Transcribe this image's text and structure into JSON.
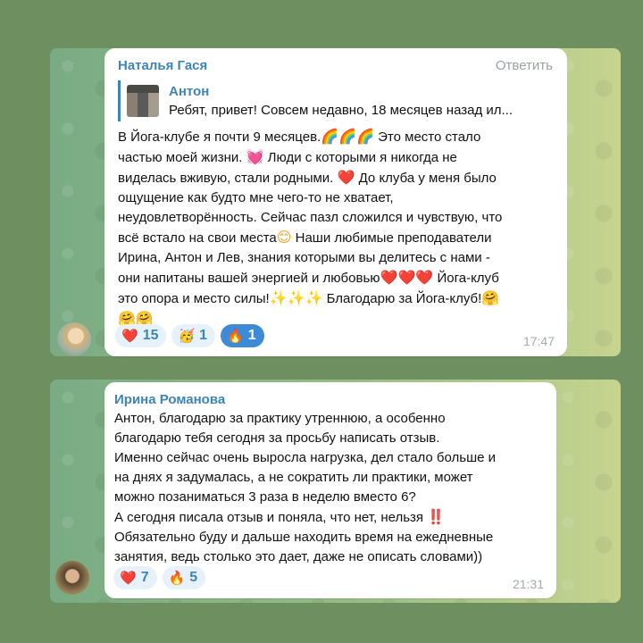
{
  "messages": [
    {
      "sender": "Наталья Гася",
      "reply_action": "Ответить",
      "quote": {
        "author": "Антон",
        "text": "Ребят, привет!  Совсем недавно, 18 месяцев назад ил..."
      },
      "lines": [
        [
          "В Йога-клубе я почти 9 месяцев.",
          "🌈🌈🌈",
          " Это место стало"
        ],
        [
          "частью моей жизни. ",
          "💓",
          " Люди с которыми я никогда не"
        ],
        [
          "виделась вживую, стали родными. ",
          "❤️",
          " До клуба у меня было"
        ],
        [
          "ощущение как будто мне чего-то не хватает,"
        ],
        [
          "неудовлетворённость. Сейчас пазл сложился и чувствую, что"
        ],
        [
          "всё встало на свои места",
          "😊",
          " Наши любимые преподаватели"
        ],
        [
          "Ирина, Антон и Лев, знания которыми вы делитесь с нами -"
        ],
        [
          "они напитаны вашей энергией и любовью",
          "❤️❤️❤️",
          " Йога-клуб"
        ],
        [
          "это опора и место силы!",
          "✨✨✨",
          "  Благодарю за Йога-клуб!",
          "🤗"
        ],
        [
          "",
          "🤗🤗"
        ]
      ],
      "reactions": [
        {
          "icon": "❤️",
          "icon_name": "heart-icon",
          "count": "15",
          "active": false
        },
        {
          "icon": "🥳",
          "icon_name": "party-face-icon",
          "count": "1",
          "active": false
        },
        {
          "icon": "🔥",
          "icon_name": "fire-icon",
          "count": "1",
          "active": true
        }
      ],
      "time": "17:47"
    },
    {
      "sender": "Ирина Романова",
      "lines": [
        [
          "Антон, благодарю за практику утреннюю, а особенно"
        ],
        [
          "благодарю тебя сегодня за просьбу написать отзыв."
        ],
        [
          "Именно сейчас очень выросла нагрузка, дел стало больше и"
        ],
        [
          "на днях я задумалась, а не сократить ли практики, может"
        ],
        [
          "можно позаниматься 3 раза в неделю вместо 6?"
        ],
        [
          "А сегодня писала отзыв и поняла, что нет, нельзя ",
          "‼️"
        ],
        [
          "Обязательно буду и дальше находить время на ежедневные"
        ],
        [
          "занятия, ведь столько это дает, даже не описать словами))"
        ]
      ],
      "reactions": [
        {
          "icon": "❤️",
          "icon_name": "heart-icon",
          "count": "7",
          "active": false
        },
        {
          "icon": "🔥",
          "icon_name": "fire-icon",
          "count": "5",
          "active": false
        }
      ],
      "time": "21:31"
    }
  ],
  "colors": {
    "accent": "#3d84b8",
    "reaction_bg": "#e7f1fa",
    "reaction_active_bg": "#3d8ad6",
    "time": "#a3a9ae"
  }
}
